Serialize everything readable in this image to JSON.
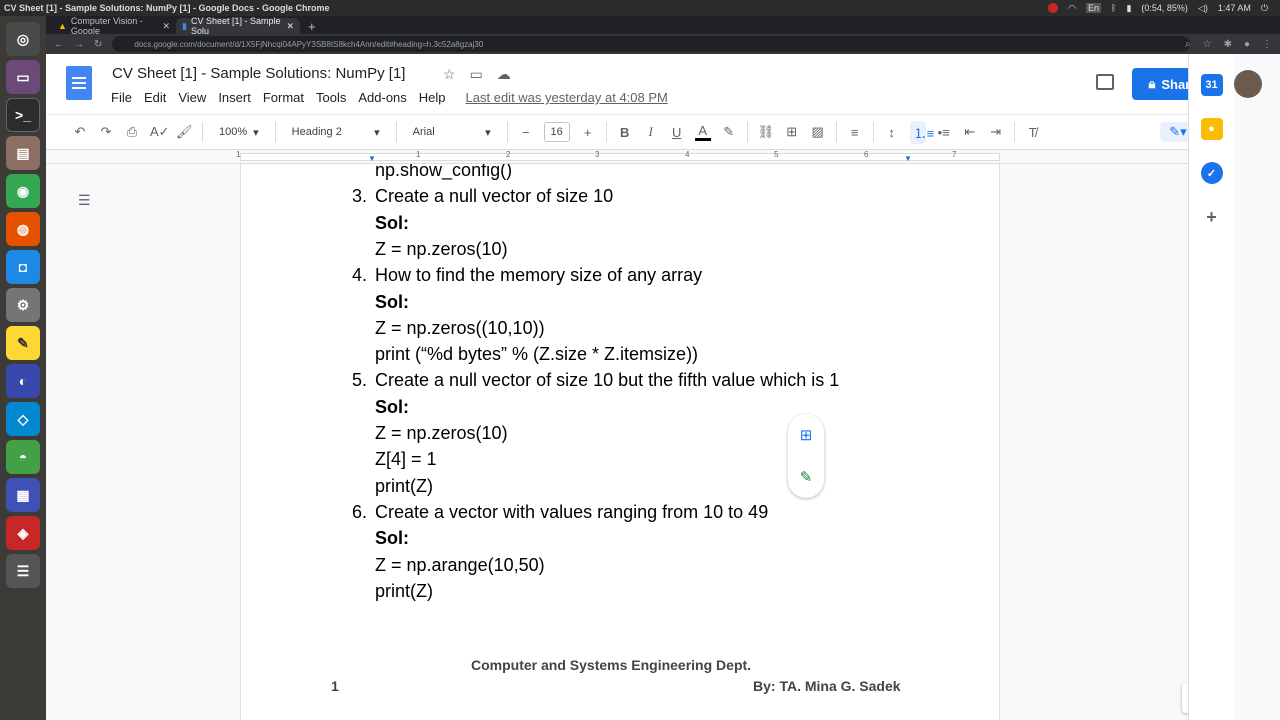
{
  "os": {
    "window_title": "CV Sheet [1] - Sample Solutions: NumPy [1] - Google Docs - Google Chrome",
    "battery": "(0:54, 85%)",
    "clock": "1:47 AM",
    "lang": "En"
  },
  "browser": {
    "tabs": [
      {
        "label": "Computer Vision - Google"
      },
      {
        "label": "CV Sheet [1] - Sample Solu"
      }
    ],
    "url": "docs.google.com/document/d/1X5FjNhcqi04APyY3SB8tS8kch4Ann/edit#heading=h.3c52a8gzaj30"
  },
  "docs": {
    "title": "CV Sheet [1] - Sample Solutions: NumPy [1]",
    "menu": [
      "File",
      "Edit",
      "View",
      "Insert",
      "Format",
      "Tools",
      "Add-ons",
      "Help"
    ],
    "last_edit": "Last edit was yesterday at 4:08 PM",
    "share_label": "Share",
    "toolbar": {
      "zoom": "100%",
      "style": "Heading 2",
      "font": "Arial",
      "font_size": "16"
    },
    "ruler_numbers": [
      "1",
      "1",
      "2",
      "3",
      "4",
      "5",
      "6",
      "7"
    ]
  },
  "document": {
    "lines": [
      {
        "num": "",
        "text": "np.show_config()",
        "bold": false
      },
      {
        "num": "3.",
        "text": "Create a null vector of size 10",
        "bold": false
      },
      {
        "num": "",
        "text": "Sol:",
        "bold": true
      },
      {
        "num": "",
        "text": "Z = np.zeros(10)",
        "bold": false
      },
      {
        "num": "4.",
        "text": "How to find the memory size of any array",
        "bold": false
      },
      {
        "num": "",
        "text": "Sol:",
        "bold": true
      },
      {
        "num": "",
        "text": "Z = np.zeros((10,10))",
        "bold": false
      },
      {
        "num": "",
        "text": "print (“%d bytes” % (Z.size * Z.itemsize))",
        "bold": false
      },
      {
        "num": "5.",
        "text": "Create a null vector of size 10 but the fifth value which is 1",
        "bold": false
      },
      {
        "num": "",
        "text": "Sol:",
        "bold": true
      },
      {
        "num": "",
        "text": "Z = np.zeros(10)",
        "bold": false
      },
      {
        "num": "",
        "text": "Z[4] = 1",
        "bold": false
      },
      {
        "num": "",
        "text": "print(Z)",
        "bold": false
      },
      {
        "num": "6.",
        "text": "Create a vector with values ranging from 10 to 49",
        "bold": false
      },
      {
        "num": "",
        "text": "Sol:",
        "bold": true
      },
      {
        "num": "",
        "text": "Z = np.arange(10,50)",
        "bold": false
      },
      {
        "num": "",
        "text": "print(Z)",
        "bold": false
      }
    ],
    "footer_dept": "Computer and Systems Engineering Dept.",
    "footer_page": "1",
    "footer_author": "By: TA. Mina G. Sadek"
  }
}
